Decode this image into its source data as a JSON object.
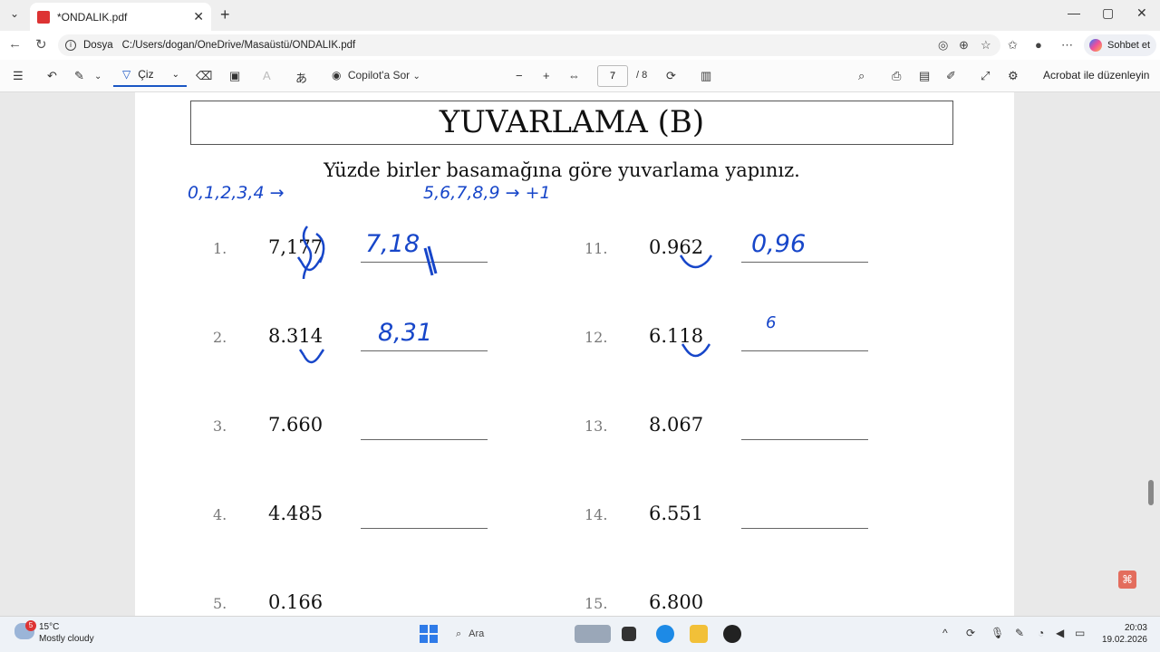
{
  "browser": {
    "tab_title": "*ONDALIK.pdf",
    "url_proto": "Dosya",
    "url": "C:/Users/dogan/OneDrive/Masaüstü/ONDALIK.pdf",
    "copilot_label": "Sohbet et"
  },
  "toolbar": {
    "draw_label": "Çiz",
    "copilot_ask": "Copilot'a Sor",
    "page_current": "7",
    "page_total": "/ 8",
    "acrobat_label": "Acrobat ile düzenleyin"
  },
  "document": {
    "title": "YUVARLAMA (B)",
    "instruction": "Yüzde birler basamağına göre yuvarlama yapınız.",
    "left_items": [
      {
        "num": "1.",
        "value": "7,177"
      },
      {
        "num": "2.",
        "value": "8.314"
      },
      {
        "num": "3.",
        "value": "7.660"
      },
      {
        "num": "4.",
        "value": "4.485"
      },
      {
        "num": "5.",
        "value": "0.166"
      }
    ],
    "right_items": [
      {
        "num": "11.",
        "value": "0.962"
      },
      {
        "num": "12.",
        "value": "6.118"
      },
      {
        "num": "13.",
        "value": "8.067"
      },
      {
        "num": "14.",
        "value": "6.551"
      },
      {
        "num": "15.",
        "value": "6.800"
      }
    ],
    "handwriting": {
      "down_digits": "0,1,2,3,4 →",
      "up_digits": "5,6,7,8,9 → +1",
      "answer_1": "7,18",
      "answer_2": "8,31",
      "answer_11": "0,96",
      "answer_12": "6"
    }
  },
  "taskbar": {
    "weather_temp": "15°C",
    "weather_desc": "Mostly cloudy",
    "weather_badge": "5",
    "search_label": "Ara",
    "time": "20:03",
    "date": "19.02.2026"
  }
}
